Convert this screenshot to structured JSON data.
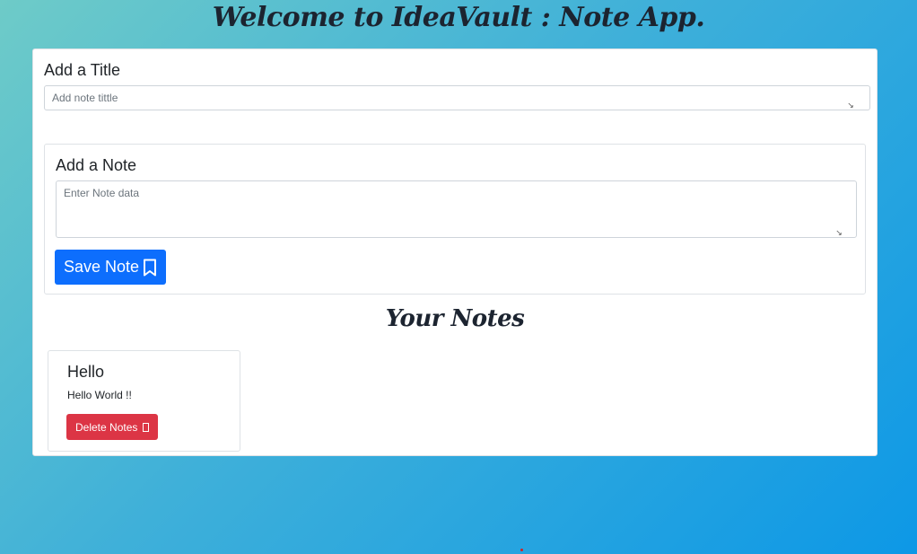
{
  "header": {
    "title": "Welcome to IdeaVault : Note App."
  },
  "title_section": {
    "label": "Add a Title",
    "input_placeholder": "Add note tittle",
    "input_value": ""
  },
  "note_section": {
    "label": "Add a Note",
    "input_placeholder": "Enter Note data",
    "input_value": "",
    "save_label": "Save Note",
    "save_icon": "bookmark-icon"
  },
  "notes_list": {
    "heading": "Your Notes",
    "items": [
      {
        "title": "Hello",
        "body": "Hello World !!",
        "delete_label": "Delete Notes",
        "delete_icon": "trash-icon"
      }
    ]
  },
  "colors": {
    "primary": "#0d6efd",
    "danger": "#dc3545",
    "stray_dot": "#d62020"
  }
}
